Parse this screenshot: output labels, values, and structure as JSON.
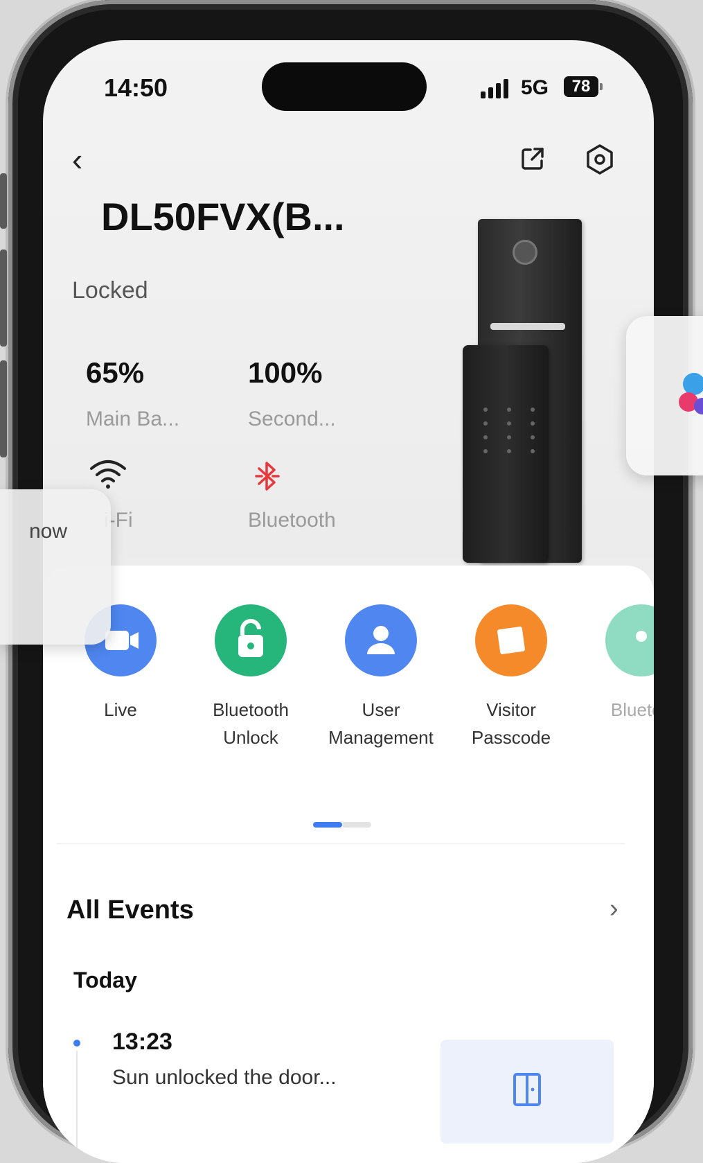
{
  "status_bar": {
    "time": "14:50",
    "network": "5G",
    "battery": "78"
  },
  "header": {
    "title": "DL50FVX(B...",
    "status": "Locked"
  },
  "stats": [
    {
      "value": "65%",
      "label": "Main Ba..."
    },
    {
      "value": "100%",
      "label": "Second..."
    }
  ],
  "connectivity": [
    {
      "label": "i-Fi",
      "icon": "wifi-icon"
    },
    {
      "label": "Bluetooth",
      "icon": "bluetooth-icon"
    }
  ],
  "actions": [
    {
      "label": "Live",
      "icon": "video-camera-icon",
      "color": "#4f86f0"
    },
    {
      "label": "Bluetooth Unlock",
      "icon": "unlock-icon",
      "color": "#26b57a"
    },
    {
      "label": "User Management",
      "icon": "user-icon",
      "color": "#4f86f0"
    },
    {
      "label": "Visitor Passcode",
      "icon": "passcode-card-icon",
      "color": "#f58a2a"
    },
    {
      "label": "Bluetod",
      "icon": "bluetooth-key-icon",
      "color": "#8fdcc2"
    }
  ],
  "events": {
    "title": "All Events",
    "group": "Today",
    "items": [
      {
        "time": "13:23",
        "description": "Sun unlocked the door..."
      }
    ]
  },
  "notification": {
    "text": "now"
  },
  "colors": {
    "accent": "#3f7cf2",
    "bluetooth_off": "#e8383d"
  }
}
